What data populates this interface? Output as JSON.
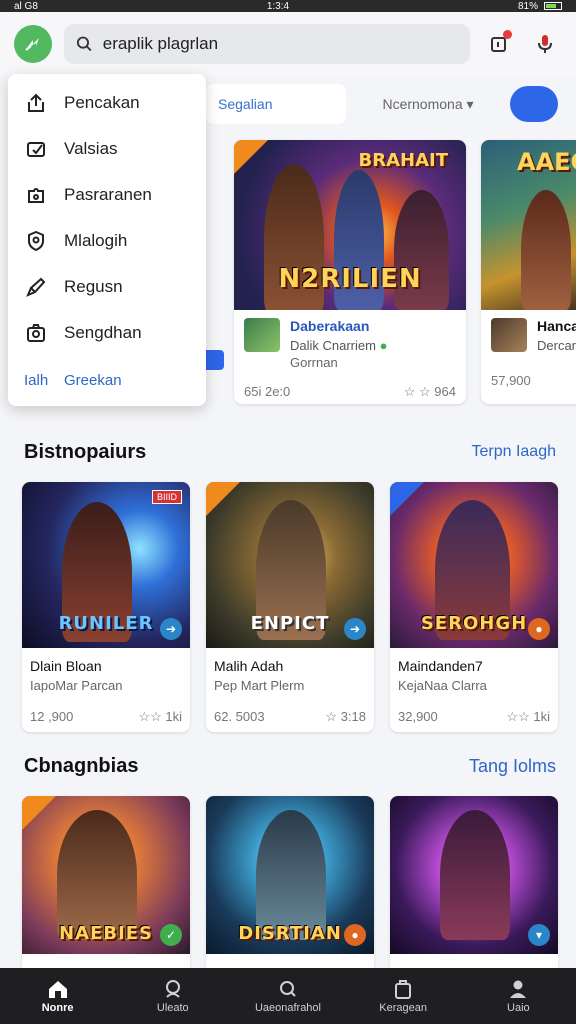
{
  "status": {
    "left": "al G8",
    "time": "1:3:4",
    "battery": "81%"
  },
  "search": {
    "value": "eraplik plagrlan"
  },
  "filter": {
    "left_label": "Segalian",
    "mid_label": "Ncernomona"
  },
  "menu": {
    "items": [
      {
        "label": "Pencakan",
        "icon": "share-icon"
      },
      {
        "label": "Valsias",
        "icon": "tag-icon"
      },
      {
        "label": "Pasraranen",
        "icon": "puzzle-icon"
      },
      {
        "label": "Mlalogih",
        "icon": "shield-icon"
      },
      {
        "label": "Regusn",
        "icon": "pen-icon"
      },
      {
        "label": "Sengdhan",
        "icon": "camera-icon"
      }
    ],
    "bottom": {
      "left": "Ialh",
      "right": "Greekan"
    }
  },
  "featured": [
    {
      "art_top": "BRAHAIT",
      "art_title": "N2RILIEN",
      "title": "Daberakaan",
      "sub": "Dalik Cnarriem",
      "sub2": "Gorrnan",
      "price": "65i 2e:0",
      "rating": "☆ ☆ 964",
      "accent": "#f08a1c"
    },
    {
      "art_top": "AAEG",
      "art_title": "",
      "title": "Hanca",
      "sub": "Dercan",
      "sub2": "",
      "price": "57,900",
      "rating": "",
      "accent": "#3a8ec8"
    }
  ],
  "section1": {
    "title": "Bistnopaiurs",
    "link": "Terpn Iaagh",
    "cards": [
      {
        "art_title": "RUNILER",
        "badge": "BIIID",
        "title": "Dlain Bloan",
        "sub": "IapoMar Parcan",
        "price": "12 ,900",
        "rating": "☆☆ 1ki",
        "btn_color": "#2a86c9"
      },
      {
        "art_title": "ENPICT",
        "badge": "",
        "title": "Malih Adah",
        "sub": "Pep Mart Plerm",
        "price": "62. 5003",
        "rating": "☆ 3:18",
        "btn_color": "#2a86c9"
      },
      {
        "art_title": "SEROHGH",
        "badge": "",
        "title": "Maindanden7",
        "sub": "KejaNaa Clarra",
        "price": "32,900",
        "rating": "☆☆ 1ki",
        "btn_color": "#e0671f"
      }
    ]
  },
  "section2": {
    "title": "Cbnagnbias",
    "link": "Tang Iolms",
    "cards": [
      {
        "art_title": "NAEBIES",
        "btn_color": "#3fae4f"
      },
      {
        "art_title": "DISRTIAN",
        "btn_color": "#e0671f"
      },
      {
        "art_title": "",
        "btn_color": "#2a86c9"
      }
    ]
  },
  "nav": [
    {
      "label": "Nonre",
      "icon": "home-icon"
    },
    {
      "label": "Uleato",
      "icon": "gamepad-icon"
    },
    {
      "label": "Uaeonafrahol",
      "icon": "search-icon"
    },
    {
      "label": "Keragean",
      "icon": "bag-icon"
    },
    {
      "label": "Uaio",
      "icon": "user-icon"
    }
  ]
}
